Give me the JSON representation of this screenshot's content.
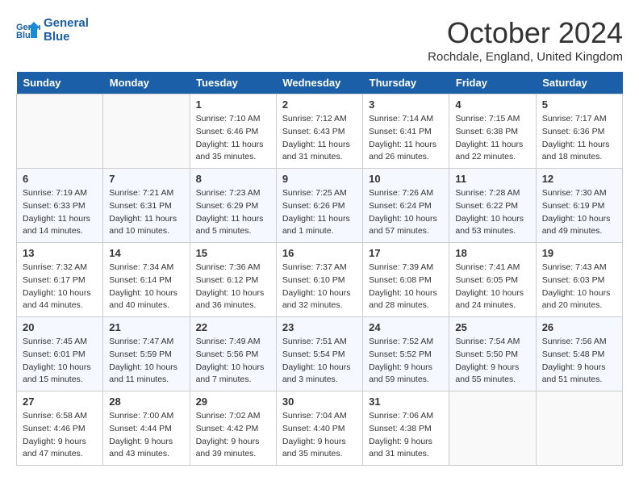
{
  "logo": {
    "line1": "General",
    "line2": "Blue"
  },
  "title": "October 2024",
  "location": "Rochdale, England, United Kingdom",
  "days_of_week": [
    "Sunday",
    "Monday",
    "Tuesday",
    "Wednesday",
    "Thursday",
    "Friday",
    "Saturday"
  ],
  "weeks": [
    [
      {
        "num": "",
        "detail": ""
      },
      {
        "num": "",
        "detail": ""
      },
      {
        "num": "1",
        "detail": "Sunrise: 7:10 AM\nSunset: 6:46 PM\nDaylight: 11 hours\nand 35 minutes."
      },
      {
        "num": "2",
        "detail": "Sunrise: 7:12 AM\nSunset: 6:43 PM\nDaylight: 11 hours\nand 31 minutes."
      },
      {
        "num": "3",
        "detail": "Sunrise: 7:14 AM\nSunset: 6:41 PM\nDaylight: 11 hours\nand 26 minutes."
      },
      {
        "num": "4",
        "detail": "Sunrise: 7:15 AM\nSunset: 6:38 PM\nDaylight: 11 hours\nand 22 minutes."
      },
      {
        "num": "5",
        "detail": "Sunrise: 7:17 AM\nSunset: 6:36 PM\nDaylight: 11 hours\nand 18 minutes."
      }
    ],
    [
      {
        "num": "6",
        "detail": "Sunrise: 7:19 AM\nSunset: 6:33 PM\nDaylight: 11 hours\nand 14 minutes."
      },
      {
        "num": "7",
        "detail": "Sunrise: 7:21 AM\nSunset: 6:31 PM\nDaylight: 11 hours\nand 10 minutes."
      },
      {
        "num": "8",
        "detail": "Sunrise: 7:23 AM\nSunset: 6:29 PM\nDaylight: 11 hours\nand 5 minutes."
      },
      {
        "num": "9",
        "detail": "Sunrise: 7:25 AM\nSunset: 6:26 PM\nDaylight: 11 hours\nand 1 minute."
      },
      {
        "num": "10",
        "detail": "Sunrise: 7:26 AM\nSunset: 6:24 PM\nDaylight: 10 hours\nand 57 minutes."
      },
      {
        "num": "11",
        "detail": "Sunrise: 7:28 AM\nSunset: 6:22 PM\nDaylight: 10 hours\nand 53 minutes."
      },
      {
        "num": "12",
        "detail": "Sunrise: 7:30 AM\nSunset: 6:19 PM\nDaylight: 10 hours\nand 49 minutes."
      }
    ],
    [
      {
        "num": "13",
        "detail": "Sunrise: 7:32 AM\nSunset: 6:17 PM\nDaylight: 10 hours\nand 44 minutes."
      },
      {
        "num": "14",
        "detail": "Sunrise: 7:34 AM\nSunset: 6:14 PM\nDaylight: 10 hours\nand 40 minutes."
      },
      {
        "num": "15",
        "detail": "Sunrise: 7:36 AM\nSunset: 6:12 PM\nDaylight: 10 hours\nand 36 minutes."
      },
      {
        "num": "16",
        "detail": "Sunrise: 7:37 AM\nSunset: 6:10 PM\nDaylight: 10 hours\nand 32 minutes."
      },
      {
        "num": "17",
        "detail": "Sunrise: 7:39 AM\nSunset: 6:08 PM\nDaylight: 10 hours\nand 28 minutes."
      },
      {
        "num": "18",
        "detail": "Sunrise: 7:41 AM\nSunset: 6:05 PM\nDaylight: 10 hours\nand 24 minutes."
      },
      {
        "num": "19",
        "detail": "Sunrise: 7:43 AM\nSunset: 6:03 PM\nDaylight: 10 hours\nand 20 minutes."
      }
    ],
    [
      {
        "num": "20",
        "detail": "Sunrise: 7:45 AM\nSunset: 6:01 PM\nDaylight: 10 hours\nand 15 minutes."
      },
      {
        "num": "21",
        "detail": "Sunrise: 7:47 AM\nSunset: 5:59 PM\nDaylight: 10 hours\nand 11 minutes."
      },
      {
        "num": "22",
        "detail": "Sunrise: 7:49 AM\nSunset: 5:56 PM\nDaylight: 10 hours\nand 7 minutes."
      },
      {
        "num": "23",
        "detail": "Sunrise: 7:51 AM\nSunset: 5:54 PM\nDaylight: 10 hours\nand 3 minutes."
      },
      {
        "num": "24",
        "detail": "Sunrise: 7:52 AM\nSunset: 5:52 PM\nDaylight: 9 hours\nand 59 minutes."
      },
      {
        "num": "25",
        "detail": "Sunrise: 7:54 AM\nSunset: 5:50 PM\nDaylight: 9 hours\nand 55 minutes."
      },
      {
        "num": "26",
        "detail": "Sunrise: 7:56 AM\nSunset: 5:48 PM\nDaylight: 9 hours\nand 51 minutes."
      }
    ],
    [
      {
        "num": "27",
        "detail": "Sunrise: 6:58 AM\nSunset: 4:46 PM\nDaylight: 9 hours\nand 47 minutes."
      },
      {
        "num": "28",
        "detail": "Sunrise: 7:00 AM\nSunset: 4:44 PM\nDaylight: 9 hours\nand 43 minutes."
      },
      {
        "num": "29",
        "detail": "Sunrise: 7:02 AM\nSunset: 4:42 PM\nDaylight: 9 hours\nand 39 minutes."
      },
      {
        "num": "30",
        "detail": "Sunrise: 7:04 AM\nSunset: 4:40 PM\nDaylight: 9 hours\nand 35 minutes."
      },
      {
        "num": "31",
        "detail": "Sunrise: 7:06 AM\nSunset: 4:38 PM\nDaylight: 9 hours\nand 31 minutes."
      },
      {
        "num": "",
        "detail": ""
      },
      {
        "num": "",
        "detail": ""
      }
    ]
  ]
}
